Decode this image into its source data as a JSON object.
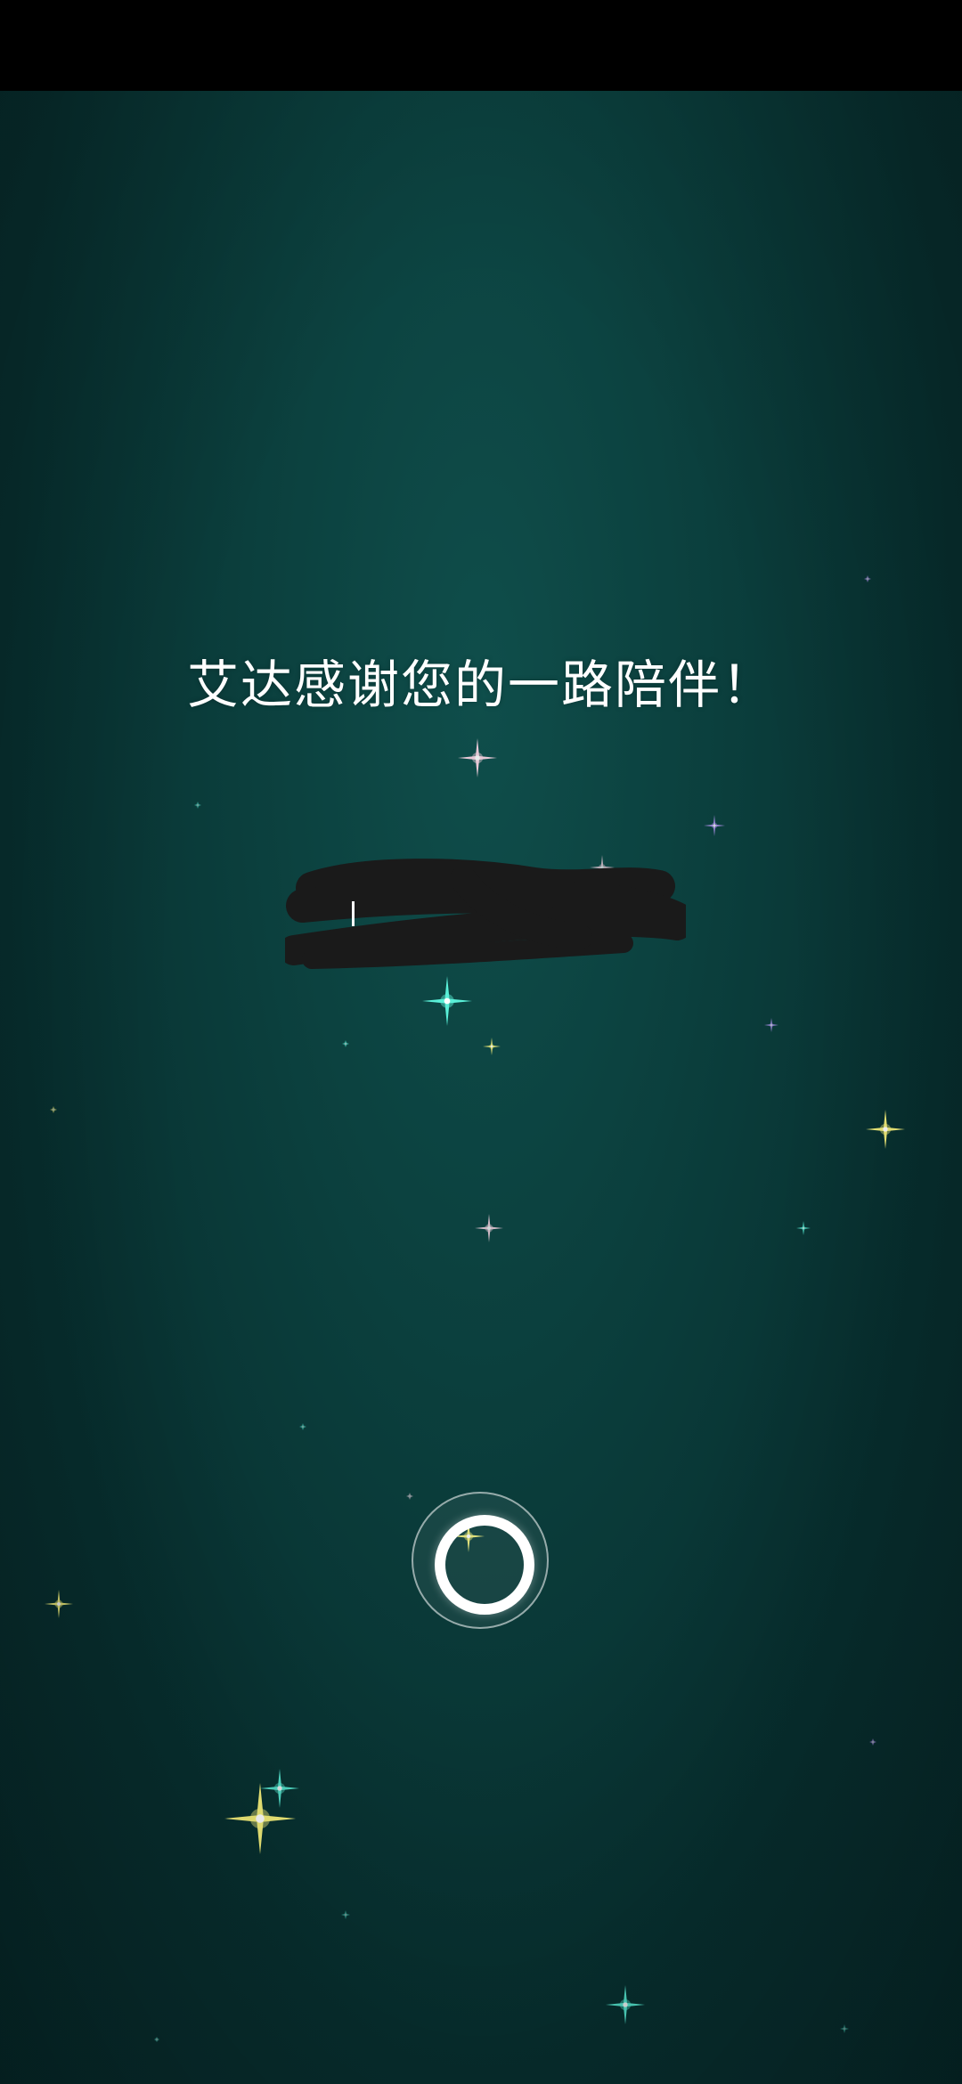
{
  "message": {
    "text": "艾达感谢您的一路陪伴！"
  },
  "colors": {
    "status_bar": "#000000",
    "background_top": "#0f4e4b",
    "background_bottom": "#062a2b",
    "text": "#ffffff",
    "sparkle_yellow": "#f4ef7a",
    "sparkle_teal": "#5af0d8",
    "sparkle_pink": "#ffd6e6",
    "sparkle_purple": "#c29bff"
  },
  "icons": {
    "continue_button": "circle-icon",
    "redaction": "scribble-mark"
  }
}
